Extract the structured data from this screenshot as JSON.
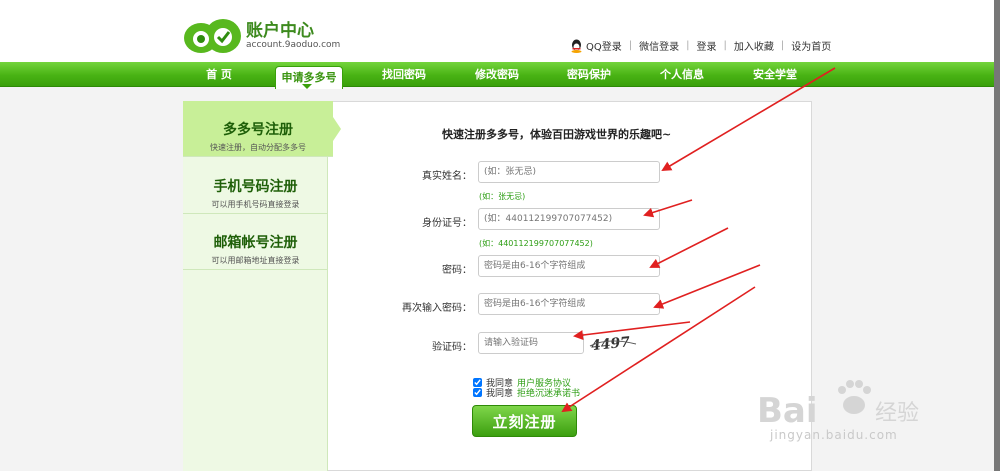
{
  "header": {
    "logo_title": "账户中心",
    "logo_domain": "account.9aoduo.com",
    "links": [
      "QQ登录",
      "微信登录",
      "登录",
      "加入收藏",
      "设为首页"
    ]
  },
  "nav": {
    "items": [
      "首 页",
      "申请多多号",
      "找回密码",
      "修改密码",
      "密码保护",
      "个人信息",
      "安全学堂"
    ],
    "active_index": 1
  },
  "sidebar": {
    "items": [
      {
        "title": "多多号注册",
        "subtitle": "快速注册，自动分配多多号"
      },
      {
        "title": "手机号码注册",
        "subtitle": "可以用手机号码直接登录"
      },
      {
        "title": "邮箱帐号注册",
        "subtitle": "可以用邮箱地址直接登录"
      }
    ]
  },
  "form": {
    "heading": "快速注册多多号，体验百田游戏世界的乐趣吧~",
    "real_name": {
      "label": "真实姓名：",
      "placeholder": "(如：张无忌)",
      "hint": "(如：张无忌)"
    },
    "id_card": {
      "label": "身份证号：",
      "placeholder": "(如：440112199707077452)",
      "hint": "(如：440112199707077452)"
    },
    "password": {
      "label": "密码：",
      "placeholder": "密码是由6-16个字符组成"
    },
    "password_confirm": {
      "label": "再次输入密码：",
      "placeholder": "密码是由6-16个字符组成"
    },
    "captcha": {
      "label": "验证码：",
      "placeholder": "请输入验证码",
      "image_text": "4497"
    },
    "agree1": {
      "prefix": "我同意",
      "link": "用户服务协议",
      "checked": true
    },
    "agree2": {
      "prefix": "我同意",
      "link": "拒绝沉迷承诺书",
      "checked": true
    },
    "submit_label": "立刻注册"
  },
  "watermark": {
    "brand": "Bai",
    "brand_suffix": "经验",
    "url": "jingyan.baidu.com"
  },
  "colors": {
    "nav_green": "#49b314",
    "active_side": "#c8ef98",
    "arrow_red": "#e02020",
    "hint_green": "#2e9e15"
  }
}
